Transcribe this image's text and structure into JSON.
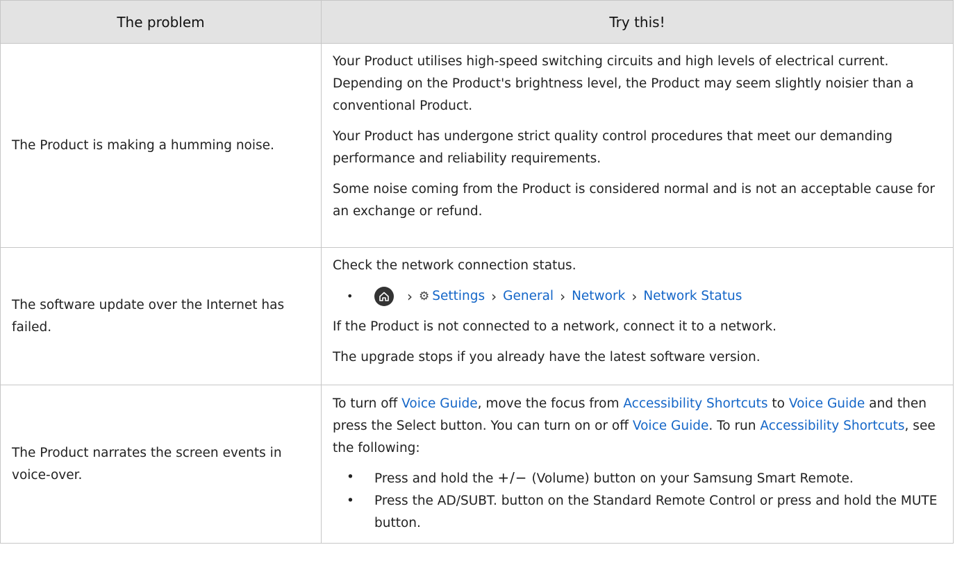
{
  "header": {
    "col1": "The problem",
    "col2": "Try this!"
  },
  "rows": [
    {
      "problem": "The Product is making a humming noise.",
      "p1": "Your Product utilises high-speed switching circuits and high levels of electrical current. Depending on the Product's brightness level, the Product may seem slightly noisier than a conventional Product.",
      "p2": "Your Product has undergone strict quality control procedures that meet our demanding performance and reliability requirements.",
      "p3": "Some noise coming from the Product is considered normal and is not an acceptable cause for an exchange or refund."
    },
    {
      "problem": "The software update over the Internet has failed.",
      "p1": "Check the network connection status.",
      "path": [
        "Settings",
        "General",
        "Network",
        "Network Status"
      ],
      "p2": "If the Product is not connected to a network, connect it to a network.",
      "p3": "The upgrade stops if you already have the latest software version."
    },
    {
      "problem": "The Product narrates the screen events in voice-over.",
      "s1": "To turn off ",
      "voice_guide": "Voice Guide",
      "s2": ", move the focus from ",
      "acc_shortcuts": "Accessibility Shortcuts",
      "s3": " to ",
      "s4": " and then press the Select button. You can turn on or off ",
      "s5": ". To run ",
      "s6": ", see the following:",
      "b1_pre": "Press and hold the ",
      "b1_sym": "+/−",
      "b1_post": " (Volume) button on your Samsung Smart Remote.",
      "b2": "Press the AD/SUBT. button on the Standard Remote Control or press and hold the MUTE button."
    }
  ],
  "icons": {
    "home": "home-icon",
    "settings": "gear-icon",
    "chevron": "chevron-right-icon"
  },
  "colors": {
    "link": "#1466c8",
    "header_bg": "#e3e3e3",
    "border": "#c6c6c6"
  }
}
